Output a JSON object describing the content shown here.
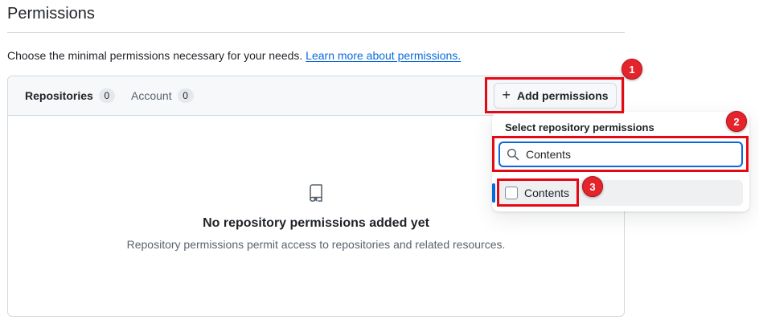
{
  "page": {
    "title": "Permissions",
    "intro_text": "Choose the minimal permissions necessary for your needs.",
    "learn_more_link": "Learn more about permissions."
  },
  "tabs": [
    {
      "label": "Repositories",
      "count": "0",
      "active": true
    },
    {
      "label": "Account",
      "count": "0",
      "active": false
    }
  ],
  "toolbar": {
    "add_permissions_label": "Add permissions"
  },
  "empty_state": {
    "icon": "repo-icon",
    "title": "No repository permissions added yet",
    "description": "Repository permissions permit access to repositories and related resources."
  },
  "dropdown": {
    "title": "Select repository permissions",
    "search_value": "Contents",
    "options": [
      {
        "label": "Contents",
        "checked": false
      }
    ]
  },
  "annotations": {
    "color": "#e50914",
    "badges": [
      "1",
      "2",
      "3"
    ]
  },
  "colors": {
    "accent": "#0969da",
    "border": "#d1d9e0",
    "muted_text": "#59636e"
  }
}
